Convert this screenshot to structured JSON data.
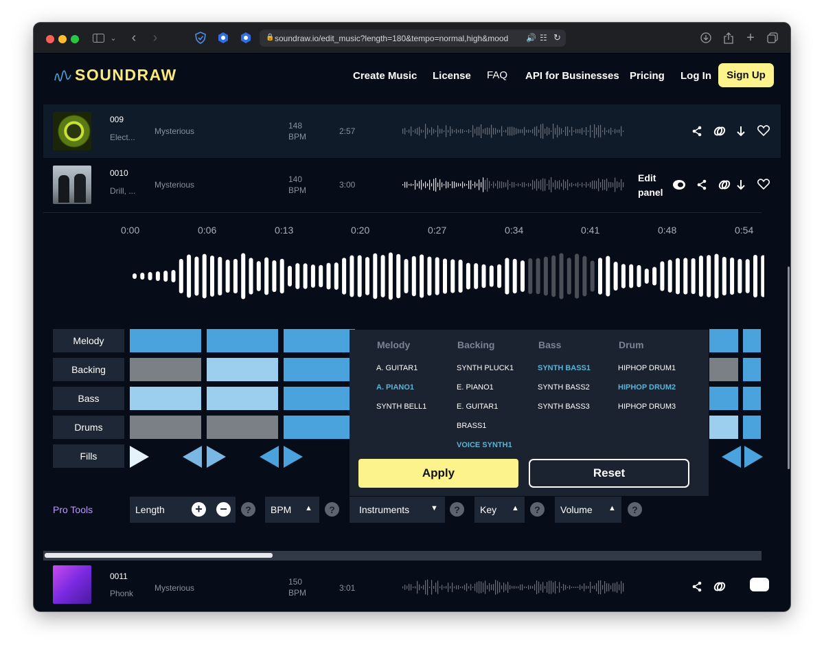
{
  "browser": {
    "url": "soundraw.io/edit_music?length=180&tempo=normal,high&mood"
  },
  "nav": {
    "logo_text": "SOUNDRAW",
    "links": [
      "Create Music",
      "License",
      "FAQ",
      "API for Businesses",
      "Pricing",
      "Log In"
    ],
    "signup": "Sign Up"
  },
  "tracks": [
    {
      "num": "009",
      "genre": "Elect...",
      "mood": "Mysterious",
      "bpm_value": "148",
      "bpm_unit": "BPM",
      "duration": "2:57"
    },
    {
      "num": "0010",
      "genre": "Drill, ...",
      "mood": "Mysterious",
      "bpm_value": "140",
      "bpm_unit": "BPM",
      "duration": "3:00",
      "edit_label_1": "Edit",
      "edit_label_2": "panel"
    },
    {
      "num": "0011",
      "genre": "Phonk",
      "mood": "Mysterious",
      "bpm_value": "150",
      "bpm_unit": "BPM",
      "duration": "3:01"
    }
  ],
  "editor": {
    "timestamps": [
      "0:00",
      "0:06",
      "0:13",
      "0:20",
      "0:27",
      "0:34",
      "0:41",
      "0:48",
      "0:54"
    ],
    "rows": [
      "Melody",
      "Backing",
      "Bass",
      "Drums",
      "Fills"
    ],
    "pro_tools": "Pro Tools",
    "controls": {
      "length": "Length",
      "bpm": "BPM",
      "instruments": "Instruments",
      "key": "Key",
      "volume": "Volume",
      "help": "?"
    }
  },
  "instrument_popup": {
    "columns": [
      {
        "header": "Melody",
        "items": [
          "A. GUITAR1",
          "A. PIANO1",
          "SYNTH BELL1"
        ],
        "selected": "A. PIANO1"
      },
      {
        "header": "Backing",
        "items": [
          "SYNTH PLUCK1",
          "E. PIANO1",
          "E. GUITAR1",
          "BRASS1",
          "VOICE SYNTH1"
        ],
        "selected": "VOICE SYNTH1"
      },
      {
        "header": "Bass",
        "items": [
          "SYNTH BASS1",
          "SYNTH BASS2",
          "SYNTH BASS3"
        ],
        "selected": "SYNTH BASS1"
      },
      {
        "header": "Drum",
        "items": [
          "HIPHOP DRUM1",
          "HIPHOP DRUM2",
          "HIPHOP DRUM3"
        ],
        "selected": "HIPHOP DRUM2"
      }
    ],
    "apply": "Apply",
    "reset": "Reset"
  },
  "colors": {
    "accent_yellow": "#fdf38d",
    "block_blue": "#4aa3dd",
    "block_light": "#9ccfee",
    "block_gray": "#7b7f86",
    "selected_text": "#5ab4d8"
  }
}
